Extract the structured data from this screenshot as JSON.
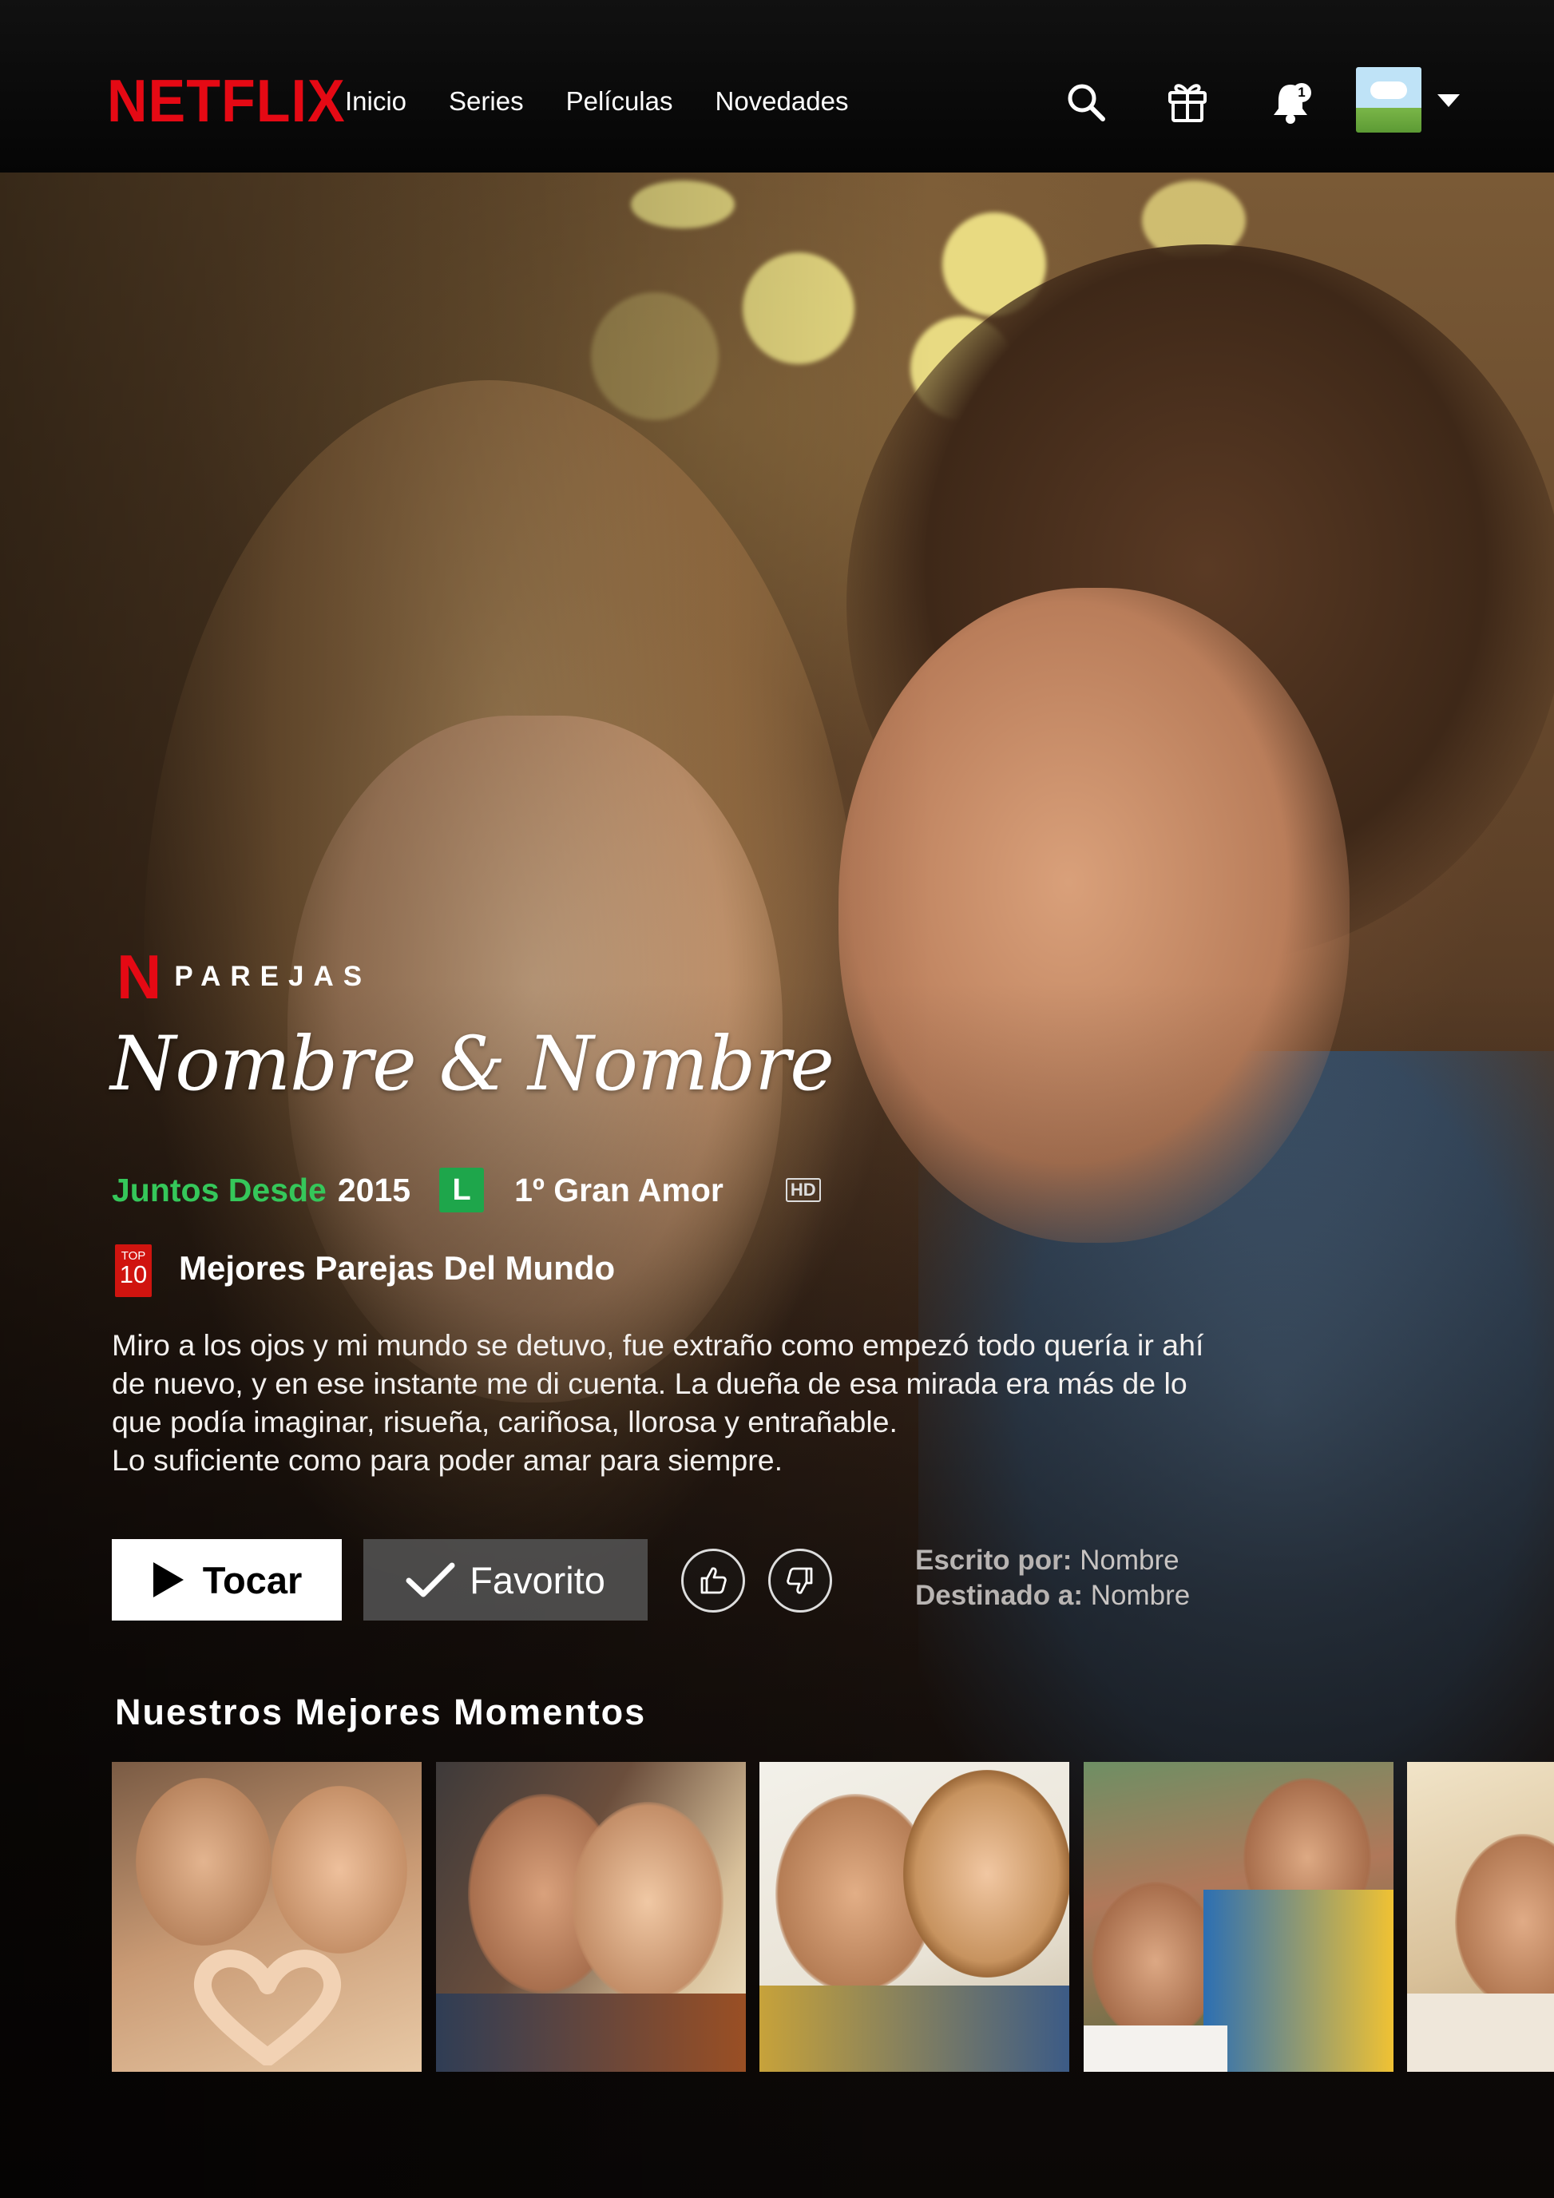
{
  "app": {
    "brand": "NETFLIX"
  },
  "nav": {
    "items": [
      {
        "label": "Inicio"
      },
      {
        "label": "Series"
      },
      {
        "label": "Películas"
      },
      {
        "label": "Novedades"
      }
    ],
    "icons": [
      "search-icon",
      "gift-icon",
      "bell-icon",
      "avatar",
      "chevron-down-icon"
    ],
    "notification_count": "1"
  },
  "hero": {
    "category": "PAREJAS",
    "title": "Nombre & Nombre",
    "meta": {
      "together_label": "Juntos Desde",
      "year": "2015",
      "rating": "L",
      "tag": "1º Gran Amor",
      "quality": "HD"
    },
    "top10": {
      "top": "TOP",
      "number": "10",
      "label": "Mejores Parejas Del Mundo"
    },
    "description": [
      "Miro a los ojos y mi mundo se detuvo, fue extraño como empezó todo quería ir ahí",
      "de nuevo, y en ese instante me di cuenta. La dueña de esa mirada era más de lo",
      "que podía imaginar, risueña, cariñosa, llorosa y entrañable.",
      "Lo suficiente como para poder amar para siempre."
    ],
    "buttons": {
      "play": "Tocar",
      "favorite": "Favorito"
    },
    "credits": {
      "written_label": "Escrito por:",
      "written_value": "Nombre",
      "for_label": "Destinado a:",
      "for_value": "Nombre"
    }
  },
  "row": {
    "title": "Nuestros Mejores Momentos"
  },
  "colors": {
    "brand_red": "#E50914",
    "green": "#35C75A",
    "rating_green": "#1EA64B"
  }
}
